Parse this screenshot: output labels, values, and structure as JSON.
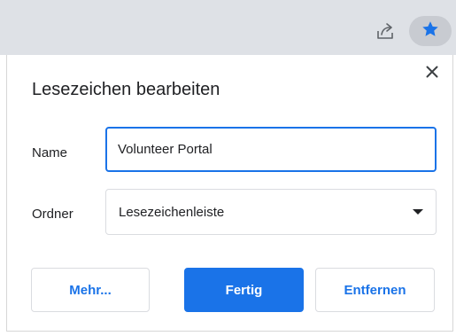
{
  "dialog": {
    "title": "Lesezeichen bearbeiten",
    "name_label": "Name",
    "name_value": "Volunteer Portal",
    "folder_label": "Ordner",
    "folder_value": "Lesezeichenleiste",
    "more_button": "Mehr...",
    "done_button": "Fertig",
    "remove_button": "Entfernen"
  },
  "toolbar": {
    "share_icon": "share-icon",
    "bookmark_icon": "star-filled-icon"
  },
  "colors": {
    "accent": "#1a73e8",
    "toolbar_bg": "#dee1e6",
    "star_bg": "#c8cbd1"
  }
}
